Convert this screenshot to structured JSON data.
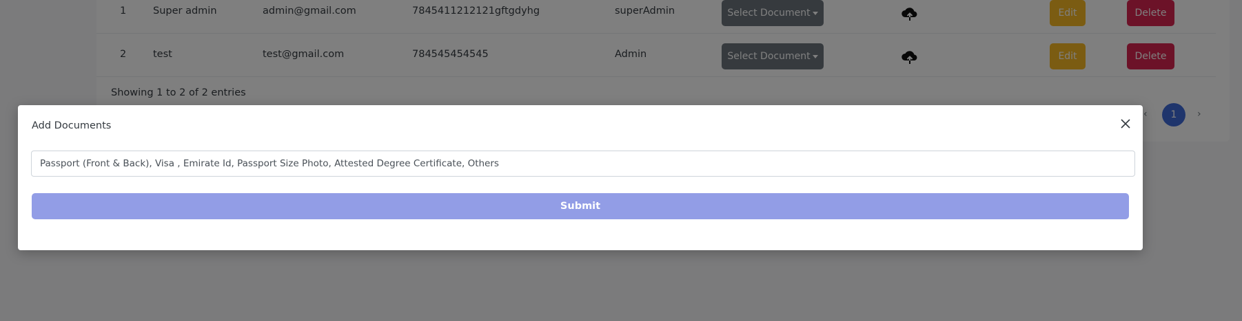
{
  "table": {
    "rows": [
      {
        "no": "1",
        "name": "Super admin",
        "email": "admin@gmail.com",
        "phone": "7845411212121gftgdyhg",
        "role": "superAdmin",
        "select_label": "Select Document",
        "upload_icon": "cloud-upload-icon",
        "edit_label": "Edit",
        "delete_label": "Delete"
      },
      {
        "no": "2",
        "name": "test",
        "email": "test@gmail.com",
        "phone": "784545454545",
        "role": "Admin",
        "select_label": "Select Document",
        "upload_icon": "cloud-upload-icon",
        "edit_label": "Edit",
        "delete_label": "Delete"
      }
    ],
    "showing_text": "Showing 1 to 2 of 2 entries"
  },
  "pagination": {
    "prev": "‹",
    "current_page": "1",
    "next": "›"
  },
  "modal": {
    "title": "Add Documents",
    "close_icon": "close-icon",
    "input_value": "Passport (Front & Back), Visa , Emirate Id, Passport Size Photo, Attested Degree Certificate, Others",
    "submit_label": "Submit"
  },
  "colors": {
    "select_button": "#6c757d",
    "edit_button": "#f7b924",
    "delete_button": "#d92550",
    "pagination_active": "#3f6ad8",
    "submit_button": "#929de6"
  }
}
